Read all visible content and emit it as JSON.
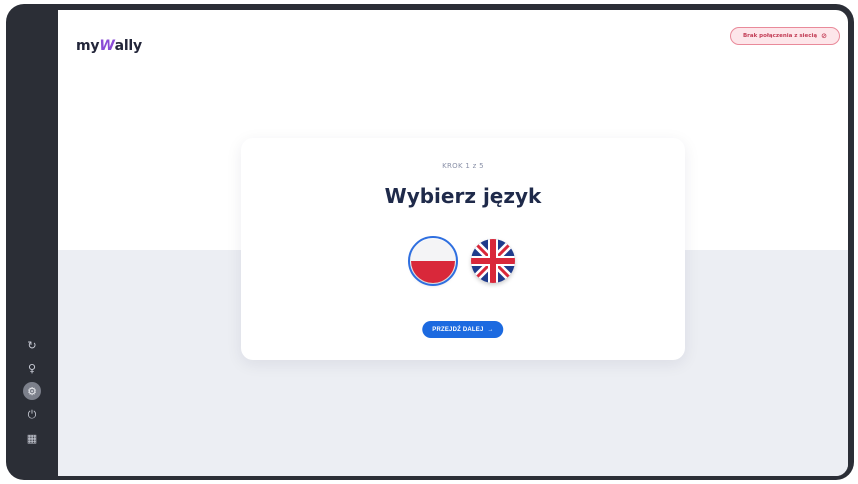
{
  "app": {
    "logo_prefix": "my",
    "logo_accent": "W",
    "logo_suffix": "ally"
  },
  "status": {
    "connection_text": "Brak połączenia z siecią",
    "connection_icon": "wifi-off-icon"
  },
  "onboarding": {
    "step_label": "KROK 1 z 5",
    "title": "Wybierz język",
    "languages": [
      {
        "name": "polish-flag",
        "selected": true
      },
      {
        "name": "english-flag",
        "selected": false
      }
    ],
    "next_label": "PRZEJDŹ DALEJ",
    "next_icon": "→"
  },
  "sidebar": {
    "items": [
      {
        "icon": "refresh-icon",
        "glyph": "↻"
      },
      {
        "icon": "lightbulb-icon",
        "glyph": "♀"
      },
      {
        "icon": "settings-icon",
        "glyph": "⚙",
        "active": true
      },
      {
        "icon": "power-icon",
        "glyph": "⏻"
      },
      {
        "icon": "grid-icon",
        "glyph": "▦"
      }
    ]
  },
  "colors": {
    "accent": "#1c6ae0",
    "title": "#1f2a4a",
    "error": "#c23c55",
    "frame": "#2b2e36"
  }
}
